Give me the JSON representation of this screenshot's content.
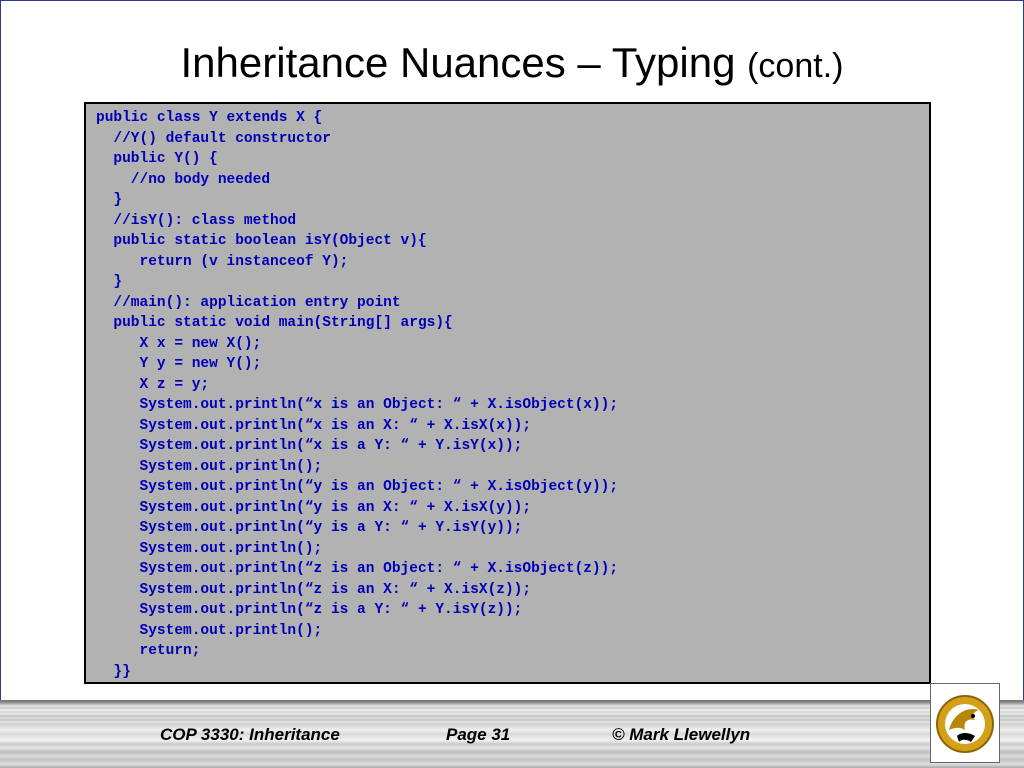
{
  "slide": {
    "title": "Inheritance Nuances – Typing",
    "title_suffix": "(cont.)",
    "code_lines": [
      "public class Y extends X {",
      "  //Y() default constructor",
      "  public Y() {",
      "    //no body needed",
      "  }",
      "  //isY(): class method",
      "  public static boolean isY(Object v){",
      "     return (v instanceof Y);",
      "  }",
      "  //main(): application entry point",
      "  public static void main(String[] args){",
      "     X x = new X();",
      "     Y y = new Y();",
      "     X z = y;",
      "     System.out.println(“x is an Object: “ + X.isObject(x));",
      "     System.out.println(“x is an X: “ + X.isX(x));",
      "     System.out.println(“x is a Y: “ + Y.isY(x));",
      "     System.out.println();",
      "     System.out.println(“y is an Object: “ + X.isObject(y));",
      "     System.out.println(“y is an X: “ + X.isX(y));",
      "     System.out.println(“y is a Y: “ + Y.isY(y));",
      "     System.out.println();",
      "     System.out.println(“z is an Object: “ + X.isObject(z));",
      "     System.out.println(“z is an X: “ + X.isX(z));",
      "     System.out.println(“z is a Y: “ + Y.isY(z));",
      "     System.out.println();",
      "     return;",
      "  }}"
    ]
  },
  "footer": {
    "course": "COP 3330:  Inheritance",
    "page": "Page 31",
    "copyright": "© Mark Llewellyn"
  },
  "colors": {
    "code_text": "#0000b8",
    "code_background": "#b2b2b2",
    "logo_gold": "#d4a017"
  },
  "icons": {
    "logo": "pegasus-logo-icon"
  }
}
